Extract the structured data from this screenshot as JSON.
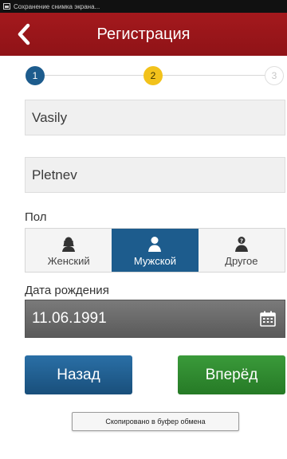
{
  "status_bar": {
    "notification": "Сохранение снимка экрана..."
  },
  "app_bar": {
    "title": "Регистрация"
  },
  "stepper": {
    "steps": [
      "1",
      "2",
      "3"
    ],
    "current": 2
  },
  "form": {
    "first_name": "Vasily",
    "last_name": "Pletnev",
    "gender_label": "Пол",
    "gender_options": [
      "Женский",
      "Мужской",
      "Другое"
    ],
    "gender_selected": "Мужской",
    "birth_date_label": "Дата рождения",
    "birth_date": "11.06.1991"
  },
  "buttons": {
    "back": "Назад",
    "next": "Вперёд"
  },
  "toast": {
    "text": "Скопировано в буфер обмена"
  },
  "colors": {
    "app_bar": "#9b171b",
    "step_done": "#1d5c8d",
    "step_current": "#f2c21b",
    "gender_selected": "#1d5c8d",
    "back_button": "#1f5e92",
    "next_button": "#2f8a2f"
  },
  "icons": {
    "back": "chevron-left-icon",
    "female": "female-user-icon",
    "male": "male-user-icon",
    "other": "other-user-icon",
    "calendar": "calendar-icon"
  }
}
